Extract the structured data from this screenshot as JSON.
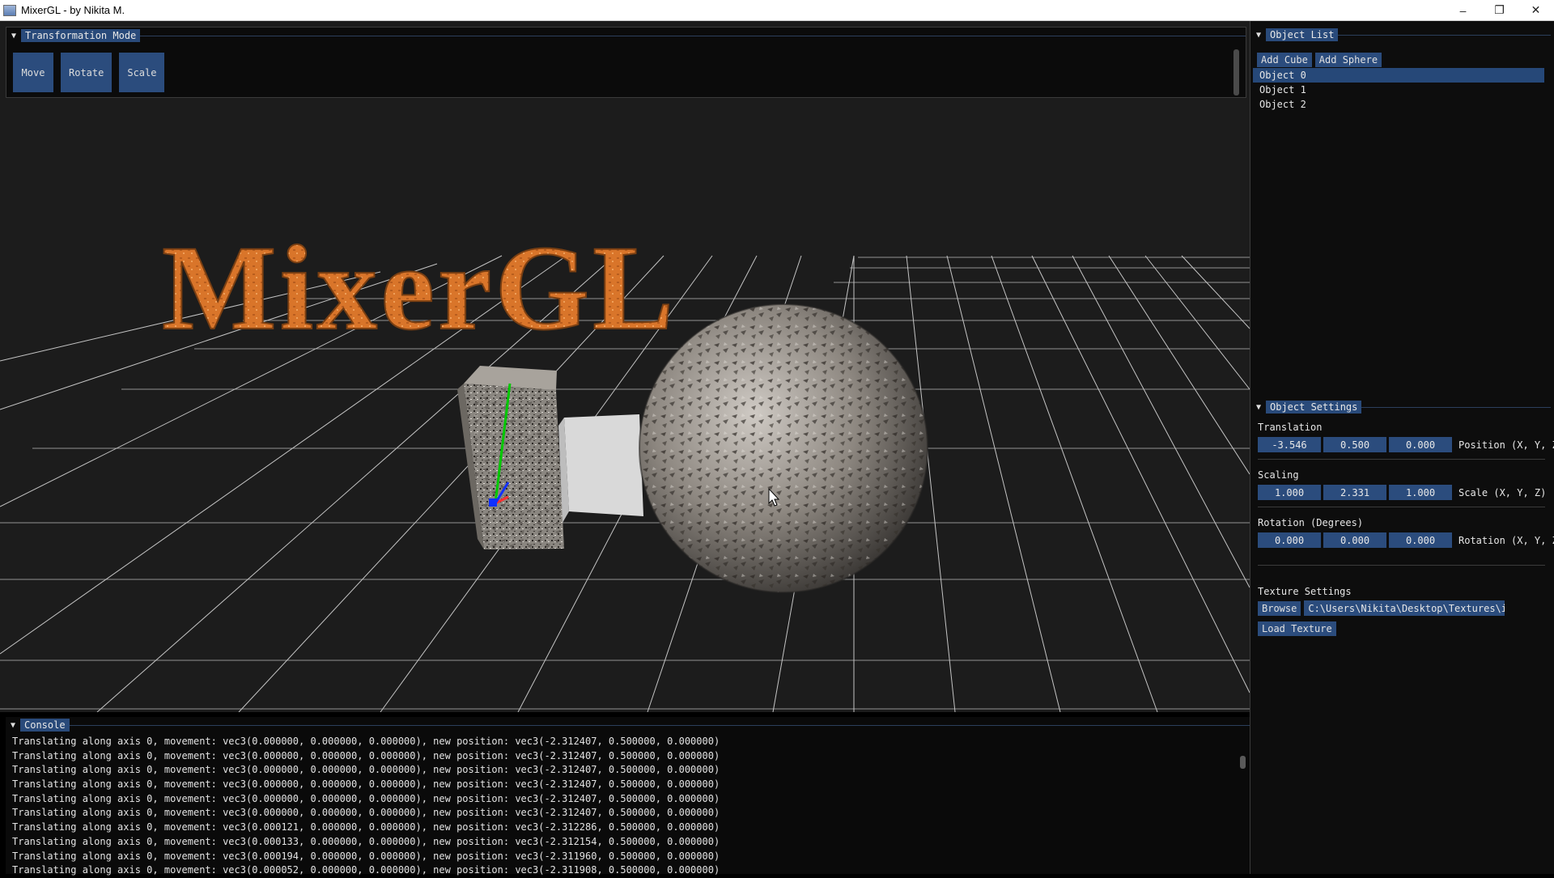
{
  "window": {
    "title": "MixerGL - by Nikita M.",
    "controls": {
      "minimize": "–",
      "restore": "❐",
      "close": "✕"
    }
  },
  "viewport": {
    "logo_text": "MixerGL",
    "logo_color": "#d9752a"
  },
  "transformation_panel": {
    "title": "Transformation Mode",
    "buttons": [
      "Move",
      "Rotate",
      "Scale"
    ]
  },
  "object_list": {
    "title": "Object List",
    "add_cube": "Add Cube",
    "add_sphere": "Add Sphere",
    "items": [
      "Object 0",
      "Object 1",
      "Object 2"
    ],
    "selected_index": 0
  },
  "object_settings": {
    "title": "Object Settings",
    "translation": {
      "label": "Translation",
      "values": [
        "-3.546",
        "0.500",
        "0.000"
      ],
      "suffix": "Position (X, Y, Z"
    },
    "scaling": {
      "label": "Scaling",
      "values": [
        "1.000",
        "2.331",
        "1.000"
      ],
      "suffix": "Scale (X, Y, Z)"
    },
    "rotation": {
      "label": "Rotation (Degrees)",
      "values": [
        "0.000",
        "0.000",
        "0.000"
      ],
      "suffix": "Rotation (X, Y, Z"
    },
    "texture": {
      "label": "Texture Settings",
      "browse": "Browse",
      "path": "C:\\Users\\Nikita\\Desktop\\Textures\\i",
      "load": "Load Texture"
    }
  },
  "console": {
    "title": "Console",
    "lines": [
      "Translating along axis 0, movement: vec3(0.000000, 0.000000, 0.000000), new position: vec3(-2.312407, 0.500000, 0.000000)",
      "Translating along axis 0, movement: vec3(0.000000, 0.000000, 0.000000), new position: vec3(-2.312407, 0.500000, 0.000000)",
      "Translating along axis 0, movement: vec3(0.000000, 0.000000, 0.000000), new position: vec3(-2.312407, 0.500000, 0.000000)",
      "Translating along axis 0, movement: vec3(0.000000, 0.000000, 0.000000), new position: vec3(-2.312407, 0.500000, 0.000000)",
      "Translating along axis 0, movement: vec3(0.000000, 0.000000, 0.000000), new position: vec3(-2.312407, 0.500000, 0.000000)",
      "Translating along axis 0, movement: vec3(0.000000, 0.000000, 0.000000), new position: vec3(-2.312407, 0.500000, 0.000000)",
      "Translating along axis 0, movement: vec3(0.000121, 0.000000, 0.000000), new position: vec3(-2.312286, 0.500000, 0.000000)",
      "Translating along axis 0, movement: vec3(0.000133, 0.000000, 0.000000), new position: vec3(-2.312154, 0.500000, 0.000000)",
      "Translating along axis 0, movement: vec3(0.000194, 0.000000, 0.000000), new position: vec3(-2.311960, 0.500000, 0.000000)",
      "Translating along axis 0, movement: vec3(0.000052, 0.000000, 0.000000), new position: vec3(-2.311908, 0.500000, 0.000000)"
    ]
  },
  "colors": {
    "accent_button": "#2b4c7d",
    "selected_row": "#264878",
    "panel_bg": "#0d0d0d"
  }
}
